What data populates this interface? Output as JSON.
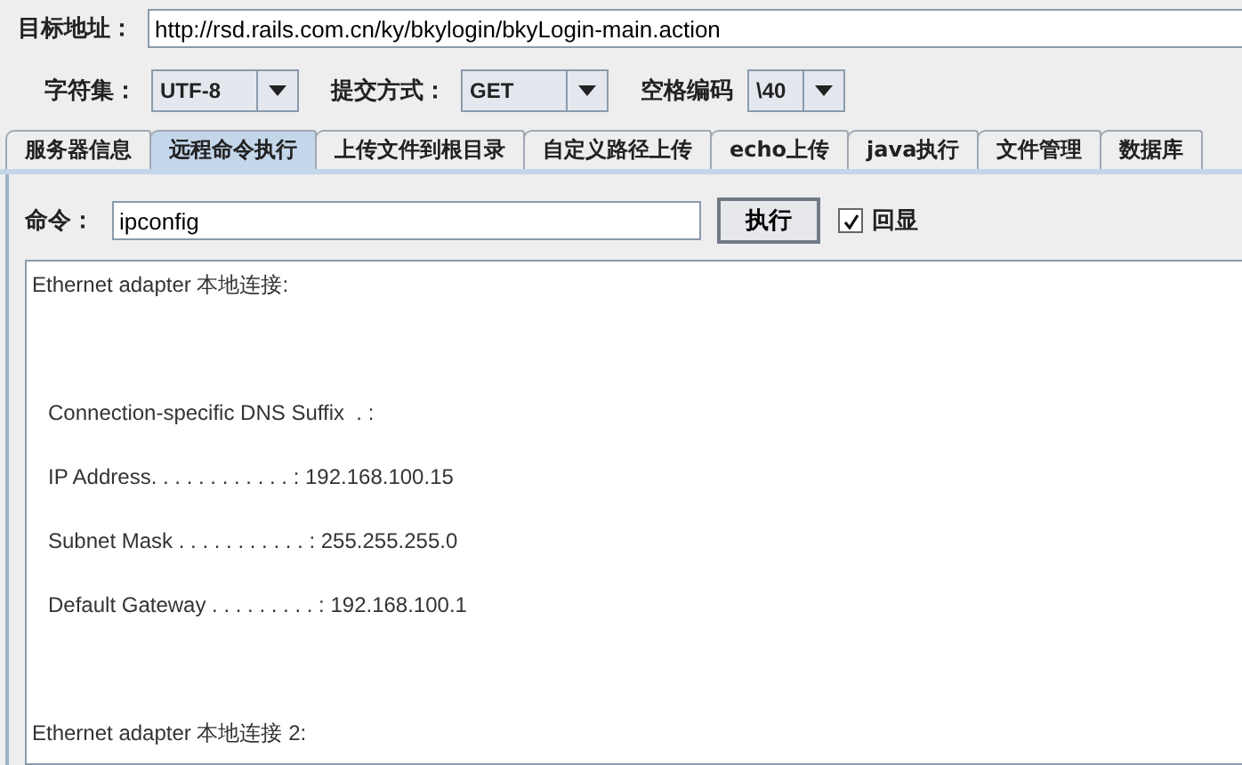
{
  "target": {
    "label": "目标地址：",
    "value": "http://rsd.rails.com.cn/ky/bkylogin/bkyLogin-main.action"
  },
  "options": [
    {
      "label": "字符集：",
      "value": "UTF-8"
    },
    {
      "label": "提交方式：",
      "value": "GET"
    },
    {
      "label": "空格编码",
      "value": "\\40"
    }
  ],
  "tabs": [
    {
      "label": "服务器信息",
      "selected": false
    },
    {
      "label": "远程命令执行",
      "selected": true
    },
    {
      "label": "上传文件到根目录",
      "selected": false
    },
    {
      "label": "自定义路径上传",
      "selected": false
    },
    {
      "label": "echo上传",
      "selected": false
    },
    {
      "label": "java执行",
      "selected": false
    },
    {
      "label": "文件管理",
      "selected": false
    },
    {
      "label": "数据库",
      "selected": false
    }
  ],
  "command": {
    "label": "命令：",
    "value": "ipconfig",
    "button": "执行",
    "echo": {
      "label": "回显",
      "checked": true
    }
  },
  "output": [
    {
      "kind": "heading",
      "text": "Ethernet adapter 本地连接:"
    },
    {
      "kind": "entry",
      "text": "Connection-specific DNS Suffix  . :"
    },
    {
      "kind": "entry",
      "text": "IP Address. . . . . . . . . . . . : 192.168.100.15"
    },
    {
      "kind": "entry",
      "text": "Subnet Mask . . . . . . . . . . . : 255.255.255.0"
    },
    {
      "kind": "entry",
      "text": "Default Gateway . . . . . . . . . : 192.168.100.1"
    },
    {
      "kind": "heading",
      "text": "Ethernet adapter 本地连接 2:"
    }
  ]
}
